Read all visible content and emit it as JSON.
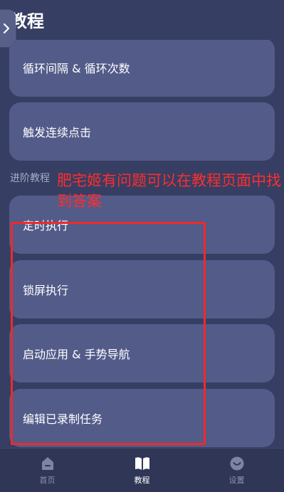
{
  "header": {
    "title": "教程"
  },
  "cards_top": [
    {
      "label": "循环间隔 & 循环次数"
    },
    {
      "label": "触发连续点击"
    }
  ],
  "section": {
    "label": "进阶教程"
  },
  "cards_advanced": [
    {
      "label": "定时执行"
    },
    {
      "label": "锁屏执行"
    },
    {
      "label": "启动应用 & 手势导航"
    },
    {
      "label": "编辑已录制任务"
    }
  ],
  "annotation": {
    "text": "肥宅姬有问题可以在教程页面中找到答案",
    "color": "#ff2d2d"
  },
  "bottom_nav": {
    "items": [
      {
        "label": "首页",
        "icon": "home-icon",
        "active": false
      },
      {
        "label": "教程",
        "icon": "book-icon",
        "active": true
      },
      {
        "label": "设置",
        "icon": "settings-icon",
        "active": false
      }
    ]
  },
  "colors": {
    "background": "#363e63",
    "card": "#535b89",
    "nav_background": "#2f3656",
    "inactive_label": "#8d93b0"
  }
}
